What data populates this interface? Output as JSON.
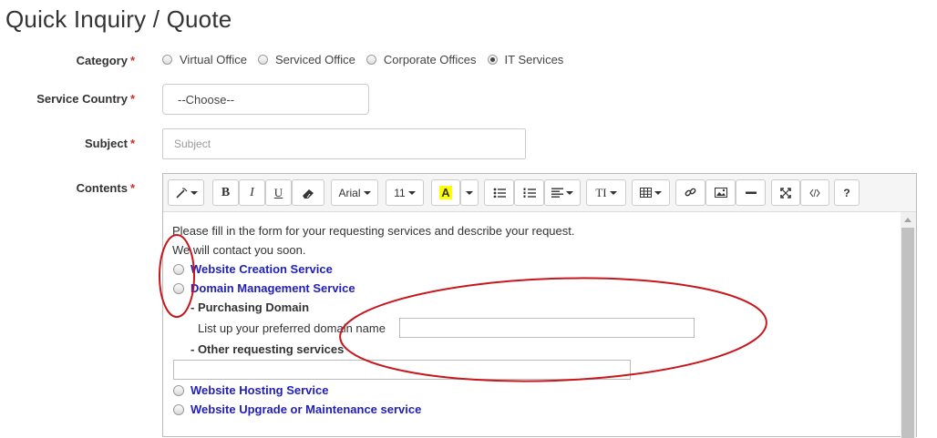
{
  "page": {
    "title": "Quick Inquiry / Quote"
  },
  "form": {
    "required_mark": "*",
    "category": {
      "label": "Category",
      "options": [
        "Virtual Office",
        "Serviced Office",
        "Corporate Offices",
        "IT Services"
      ],
      "selected": "IT Services"
    },
    "service_country": {
      "label": "Service Country",
      "value": "--Choose--"
    },
    "subject": {
      "label": "Subject",
      "placeholder": "Subject"
    },
    "contents": {
      "label": "Contents"
    }
  },
  "toolbar": {
    "font_name": "Arial",
    "font_size": "11",
    "bold": "B",
    "italic": "I",
    "underline": "U",
    "highlight": "A",
    "text_style": "TI",
    "help": "?"
  },
  "editor": {
    "intro_line1": "Please fill in the form for your requesting services and describe your request.",
    "intro_line2": "We will contact you soon.",
    "services": [
      "Website Creation Service",
      "Domain Management Service",
      "Website Hosting Service",
      "Website Upgrade or Maintenance service"
    ],
    "purchasing_domain": "- Purchasing Domain",
    "preferred_domain_label": "List up your preferred domain name",
    "other_services": "- Other requesting services"
  },
  "colors": {
    "link": "#1f1fb8",
    "required": "#c9302c",
    "annotation": "#c8161d",
    "highlight": "#ffff00"
  }
}
